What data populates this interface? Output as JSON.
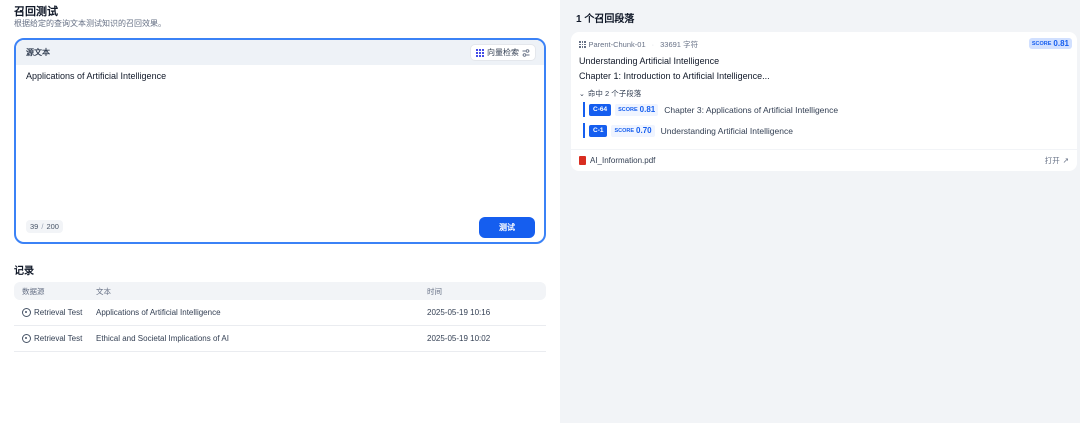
{
  "left_panel": {
    "title": "召回测试",
    "subtitle": "根据给定的查询文本测试知识的召回效果。",
    "query": {
      "label": "源文本",
      "method_label": "向量检索",
      "text": "Applications of Artificial Intelligence",
      "char_count": "39",
      "char_limit": "200",
      "test_button": "测试"
    },
    "records": {
      "title": "记录",
      "columns": [
        "数据源",
        "文本",
        "时间"
      ],
      "rows": [
        {
          "source": "Retrieval Test",
          "text": "Applications of Artificial Intelligence",
          "time": "2025-05-19 10:16"
        },
        {
          "source": "Retrieval Test",
          "text": "Ethical and Societal Implications of AI",
          "time": "2025-05-19 10:02"
        }
      ]
    }
  },
  "right_panel": {
    "title": "1 个召回段落",
    "result": {
      "chunk_name": "Parent-Chunk-01",
      "char_count": "33691 字符",
      "score_label": "SCORE",
      "score": "0.81",
      "line1": "Understanding Artificial Intelligence",
      "line2": "Chapter 1: Introduction to Artificial Intelligence...",
      "hits_label": "命中 2 个子段落",
      "children": [
        {
          "chip": "C-64",
          "score_label": "SCORE",
          "score": "0.81",
          "text": "Chapter 3: Applications of Artificial Intelligence"
        },
        {
          "chip": "C-1",
          "score_label": "SCORE",
          "score": "0.70",
          "text": "Understanding Artificial Intelligence"
        }
      ],
      "file_name": "AI_Information.pdf",
      "open_label": "打开",
      "open_arrow": "↗"
    }
  },
  "colors": {
    "accent": "#155eef",
    "focus_border": "#3b82f6",
    "right_bg": "#f2f4f7"
  }
}
